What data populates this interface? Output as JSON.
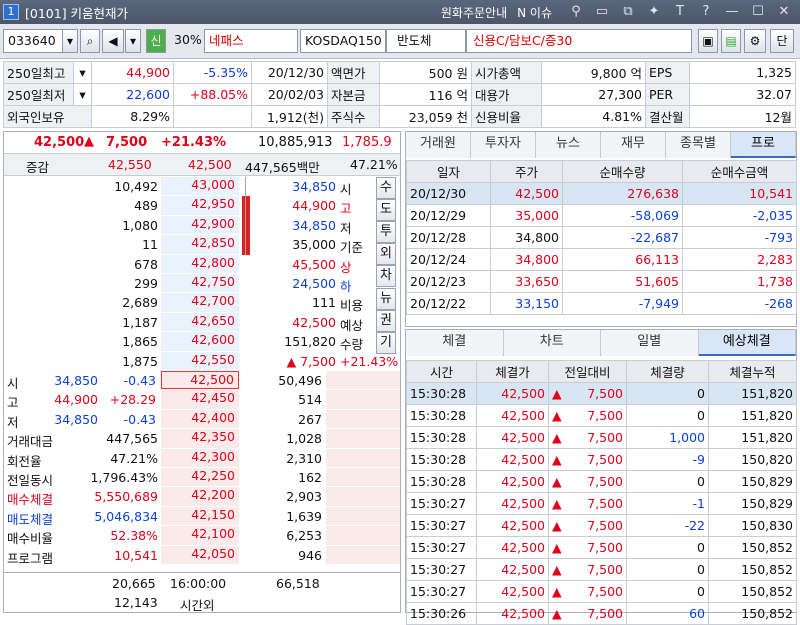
{
  "window": {
    "num": "1",
    "title": "[0101] 키움현재가",
    "order_info": "원화주문안내",
    "news": "N 이슈"
  },
  "toolbar": {
    "code": "033640",
    "credit": "신",
    "ratio": "30%",
    "name": "네패스",
    "market": "KOSDAQ150",
    "sector": "반도체",
    "credit_info": "신용C/담보C/증30",
    "btn_last": "단"
  },
  "info": [
    [
      "250일최고",
      "44,900",
      "-5.35%",
      "20/12/30",
      "액면가",
      "500 원",
      "시가총액",
      "9,800 억",
      "EPS",
      "1,325"
    ],
    [
      "250일최저",
      "22,600",
      "+88.05%",
      "20/02/03",
      "자본금",
      "116 억",
      "대용가",
      "27,300",
      "PER",
      "32.07"
    ],
    [
      "외국인보유",
      "8.29%",
      "",
      "1,912(천)",
      "주식수",
      "23,059 천",
      "신용비율",
      "4.81%",
      "결산월",
      "12월"
    ]
  ],
  "summary": {
    "price": "42,500",
    "arrow": "▲",
    "change": "7,500",
    "rate": "+21.43%",
    "volume": "10,885,913",
    "vol_ratio": "1,785.9"
  },
  "orderbook": {
    "top_label": "증감",
    "top_ask": "42,550",
    "top_price": "42,500",
    "top_amount": "447,565백만",
    "top_rate": "47.21%",
    "asks": [
      [
        "10,492",
        "43,000"
      ],
      [
        "489",
        "42,950"
      ],
      [
        "1,080",
        "42,900"
      ],
      [
        "11",
        "42,850"
      ],
      [
        "678",
        "42,800"
      ],
      [
        "299",
        "42,750"
      ],
      [
        "2,689",
        "42,700"
      ],
      [
        "1,187",
        "42,650"
      ],
      [
        "1,865",
        "42,600"
      ],
      [
        "1,875",
        "42,550"
      ]
    ],
    "bids": [
      [
        "42,500",
        "50,496"
      ],
      [
        "42,450",
        "514"
      ],
      [
        "42,400",
        "267"
      ],
      [
        "42,350",
        "1,028"
      ],
      [
        "42,300",
        "2,310"
      ],
      [
        "42,250",
        "162"
      ],
      [
        "42,200",
        "2,903"
      ],
      [
        "42,150",
        "1,639"
      ],
      [
        "42,100",
        "6,253"
      ],
      [
        "42,050",
        "946"
      ]
    ],
    "info_right": [
      [
        "34,850",
        "시"
      ],
      [
        "44,900",
        "고"
      ],
      [
        "34,850",
        "저"
      ],
      [
        "35,000",
        "기준"
      ],
      [
        "45,500",
        "상"
      ],
      [
        "24,500",
        "하"
      ],
      [
        "111",
        "비용"
      ],
      [
        "42,500",
        "예상"
      ],
      [
        "151,820",
        "수량"
      ],
      [
        "▲ 7,500",
        "+21.43%"
      ]
    ],
    "side_buttons": [
      "수",
      "도",
      "투",
      "외",
      "차",
      "뉴",
      "권",
      "기"
    ],
    "left_info": [
      [
        "시",
        "34,850",
        "-0.43"
      ],
      [
        "고",
        "44,900",
        "+28.29"
      ],
      [
        "저",
        "34,850",
        "-0.43"
      ],
      [
        "거래대금",
        "447,565",
        ""
      ],
      [
        "회전율",
        "47.21%",
        ""
      ],
      [
        "전일동시",
        "1,796.43%",
        ""
      ],
      [
        "매수체결",
        "5,550,689",
        ""
      ],
      [
        "매도체결",
        "5,046,834",
        ""
      ],
      [
        "매수비율",
        "52.38%",
        ""
      ],
      [
        "프로그램",
        "10,541",
        ""
      ]
    ],
    "bottom": {
      "ask_total": "20,665",
      "time": "16:00:00",
      "bid_total": "66,518",
      "after": "12,143",
      "after_label": "시간외"
    }
  },
  "right_tabs": [
    "거래원",
    "투자자",
    "뉴스",
    "재무",
    "종목별",
    "프로"
  ],
  "program": {
    "headers": [
      "일자",
      "주가",
      "순매수량",
      "순매수금액"
    ],
    "rows": [
      [
        "20/12/30",
        "42,500",
        "276,638",
        "10,541"
      ],
      [
        "20/12/29",
        "35,000",
        "-58,069",
        "-2,035"
      ],
      [
        "20/12/28",
        "34,800",
        "-22,687",
        "-793"
      ],
      [
        "20/12/24",
        "34,800",
        "66,113",
        "2,283"
      ],
      [
        "20/12/23",
        "33,650",
        "51,605",
        "1,738"
      ],
      [
        "20/12/22",
        "33,150",
        "-7,949",
        "-268"
      ]
    ]
  },
  "bottom_tabs": [
    "체결",
    "차트",
    "일별",
    "예상체결"
  ],
  "trades": {
    "headers": [
      "시간",
      "체결가",
      "전일대비",
      "체결량",
      "체결누적"
    ],
    "rows": [
      [
        "15:30:28",
        "42,500",
        "7,500",
        "0",
        "151,820"
      ],
      [
        "15:30:28",
        "42,500",
        "7,500",
        "0",
        "151,820"
      ],
      [
        "15:30:28",
        "42,500",
        "7,500",
        "1,000",
        "151,820"
      ],
      [
        "15:30:28",
        "42,500",
        "7,500",
        "-9",
        "150,820"
      ],
      [
        "15:30:28",
        "42,500",
        "7,500",
        "0",
        "150,829"
      ],
      [
        "15:30:27",
        "42,500",
        "7,500",
        "-1",
        "150,829"
      ],
      [
        "15:30:27",
        "42,500",
        "7,500",
        "-22",
        "150,830"
      ],
      [
        "15:30:27",
        "42,500",
        "7,500",
        "0",
        "150,852"
      ],
      [
        "15:30:27",
        "42,500",
        "7,500",
        "0",
        "150,852"
      ],
      [
        "15:30:27",
        "42,500",
        "7,500",
        "0",
        "150,852"
      ],
      [
        "15:30:26",
        "42,500",
        "7,500",
        "60",
        "150,852"
      ]
    ]
  }
}
